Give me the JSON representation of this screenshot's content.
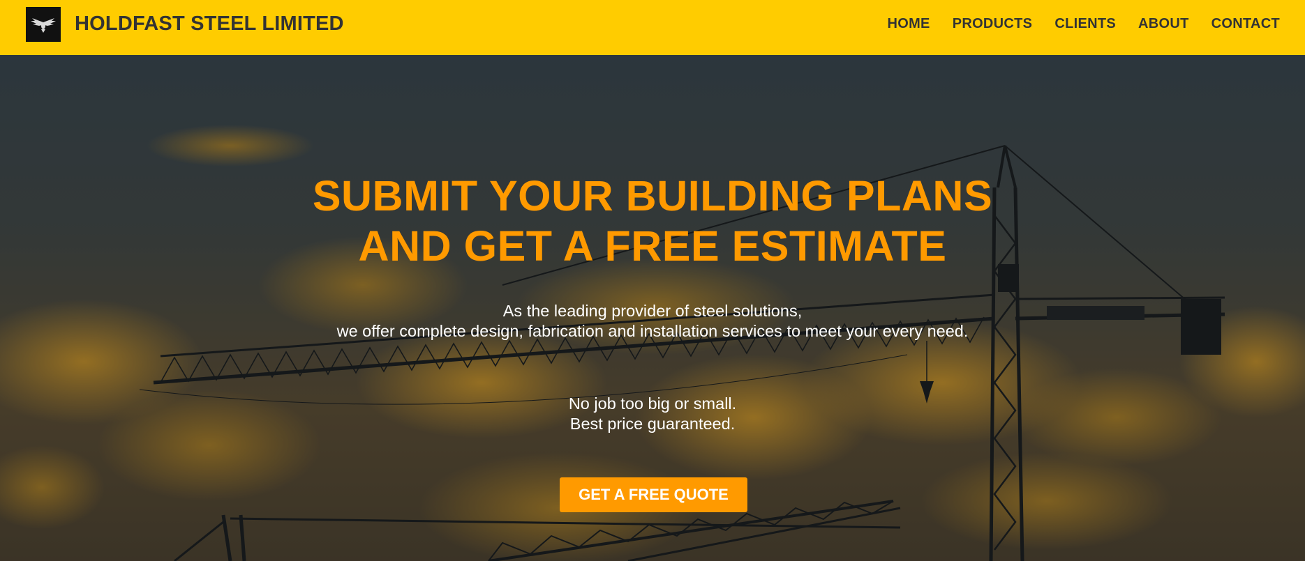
{
  "brand": {
    "name": "HOLDFAST STEEL LIMITED",
    "logo_icon": "eagle-wings-icon"
  },
  "nav": {
    "items": [
      {
        "label": "HOME"
      },
      {
        "label": "PRODUCTS"
      },
      {
        "label": "CLIENTS"
      },
      {
        "label": "ABOUT"
      },
      {
        "label": "CONTACT"
      }
    ]
  },
  "hero": {
    "headline_line1": "SUBMIT YOUR BUILDING PLANS",
    "headline_line2": "AND GET A FREE ESTIMATE",
    "subtitle_line1": "As the leading provider of steel solutions,",
    "subtitle_line2": "we offer complete design, fabrication and installation services to meet your every need.",
    "tagline_line1": "No job too big or small.",
    "tagline_line2": "Best price guaranteed.",
    "cta_label": "GET A FREE QUOTE",
    "background": "construction-cranes-sunset-photo"
  },
  "colors": {
    "header_bg": "#ffcc00",
    "accent_orange": "#ff9a00",
    "nav_text": "#333333",
    "hero_text": "#ffffff"
  }
}
